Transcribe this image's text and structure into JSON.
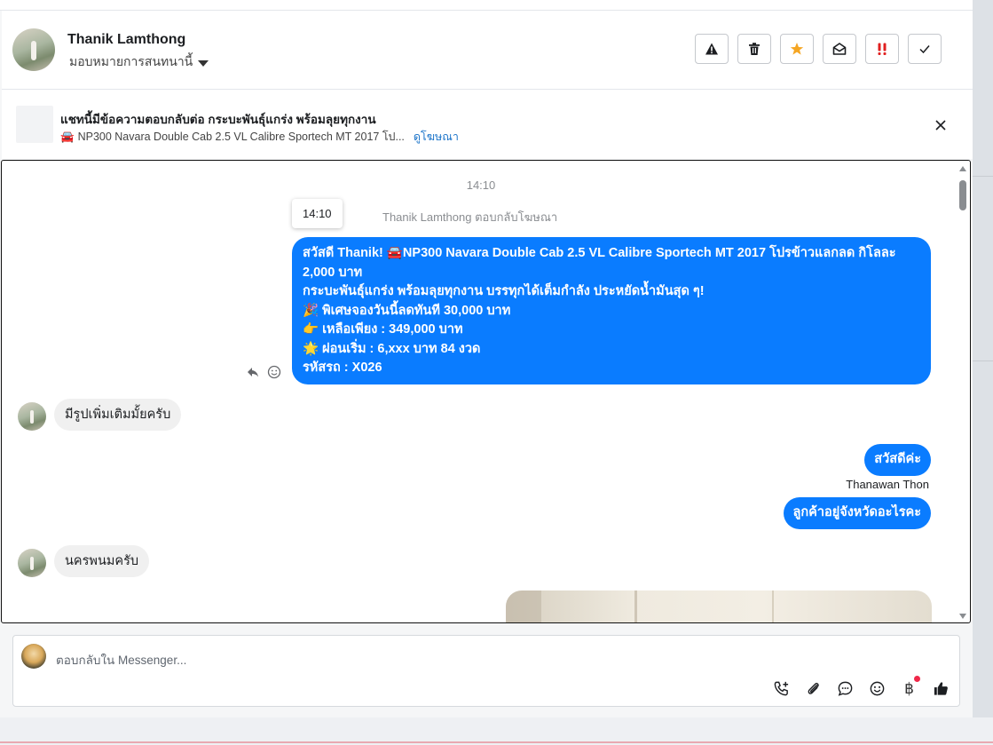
{
  "header": {
    "name": "Thanik Lamthong",
    "assign_label": "มอบหมายการสนทนานี้",
    "toolbar": [
      {
        "name": "report-spam-button",
        "icon": "warning-icon"
      },
      {
        "name": "delete-button",
        "icon": "trash-icon"
      },
      {
        "name": "star-button",
        "icon": "star-icon",
        "color": "#f5a623"
      },
      {
        "name": "mark-unread-button",
        "icon": "envelope-open-icon"
      },
      {
        "name": "priority-button",
        "icon": "exclamation-icon",
        "color": "#e02020"
      },
      {
        "name": "done-button",
        "icon": "checkmark-icon"
      }
    ]
  },
  "ad_banner": {
    "title": "แชทนี้มีข้อความตอบกลับต่อ กระบะพันธุ์แกร่ง พร้อมลุยทุกงาน",
    "subtitle_emoji": "🚘",
    "subtitle": "NP300 Navara Double Cab 2.5 VL Calibre Sportech MT 2017 โป...",
    "link": "ดูโฆษณา"
  },
  "chat": {
    "time_center": "14:10",
    "tooltip_time": "14:10",
    "reply_note": "Thanik Lamthong ตอบกลับโฆษณา",
    "ad_message_lines": [
      "สวัสดี Thanik! 🚘NP300 Navara Double Cab 2.5 VL Calibre Sportech MT 2017 โปรข้าวแลกลด กิโลละ",
      "2,000 บาท",
      "กระบะพันธุ์แกร่ง พร้อมลุยทุกงาน บรรทุกได้เต็มกำลัง ประหยัดน้ำมันสุด ๆ!",
      "🎉 พิเศษจองวันนี้ลดทันที 30,000 บาท",
      "👉 เหลือเพียง : 349,000 บาท",
      "🌟 ผ่อนเริ่ม : 6,xxx บาท 84 งวด",
      "รหัสรถ : X026"
    ],
    "incoming_1": "มีรูปเพิ่มเติมมั้ยครับ",
    "outgoing_1": "สวัสดีค่ะ",
    "sender_name": "Thanawan Thon",
    "outgoing_2": "ลูกค้าอยู่จังหวัดอะไรคะ",
    "incoming_2": "นครพนมครับ"
  },
  "composer": {
    "placeholder": "ตอบกลับใน Messenger...",
    "currency_symbol": "฿",
    "icons": [
      "call-plus-icon",
      "paperclip-icon",
      "saved-reply-icon",
      "emoji-icon",
      "payment-icon",
      "thumbs-up-icon"
    ]
  },
  "colors": {
    "outgoing_bubble": "#0a7cff",
    "incoming_bubble": "#f0f0f0",
    "link": "#1a73c9"
  }
}
